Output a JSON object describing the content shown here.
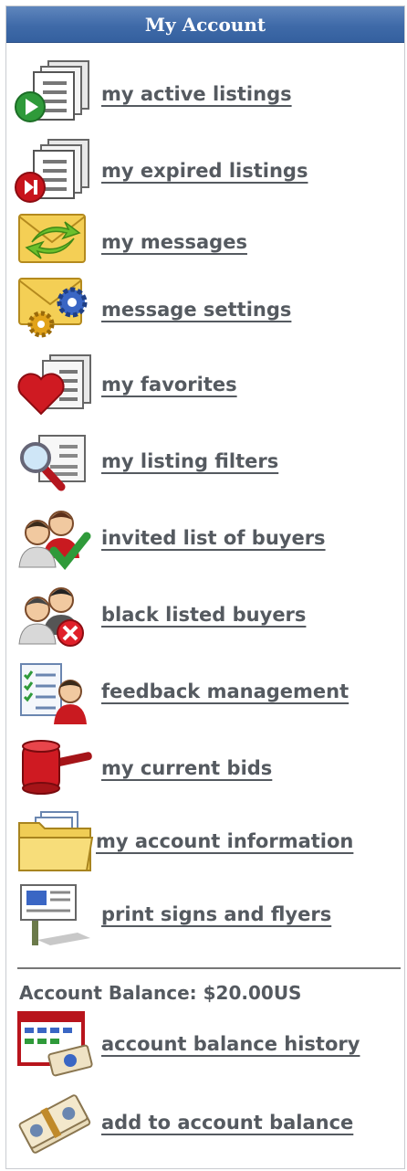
{
  "header": {
    "title": "My Account"
  },
  "menu": [
    {
      "label": "my active listings",
      "icon": "active-listings-icon"
    },
    {
      "label": "my expired listings",
      "icon": "expired-listings-icon"
    },
    {
      "label": "my messages",
      "icon": "messages-icon"
    },
    {
      "label": "message settings",
      "icon": "message-settings-icon"
    },
    {
      "label": "my favorites",
      "icon": "favorites-icon"
    },
    {
      "label": "my listing filters",
      "icon": "listing-filters-icon"
    },
    {
      "label": "invited list of buyers",
      "icon": "invited-buyers-icon"
    },
    {
      "label": "black listed buyers",
      "icon": "blacklisted-buyers-icon"
    },
    {
      "label": "feedback management",
      "icon": "feedback-icon"
    },
    {
      "label": "my current bids",
      "icon": "gavel-icon"
    },
    {
      "label": "my account information",
      "icon": "folder-icon"
    },
    {
      "label": "print signs and flyers",
      "icon": "sign-icon"
    }
  ],
  "balance": {
    "text": "Account Balance: $20.00US"
  },
  "balance_links": [
    {
      "label": "account balance history",
      "icon": "balance-history-icon"
    },
    {
      "label": "add to account balance",
      "icon": "money-icon"
    }
  ]
}
